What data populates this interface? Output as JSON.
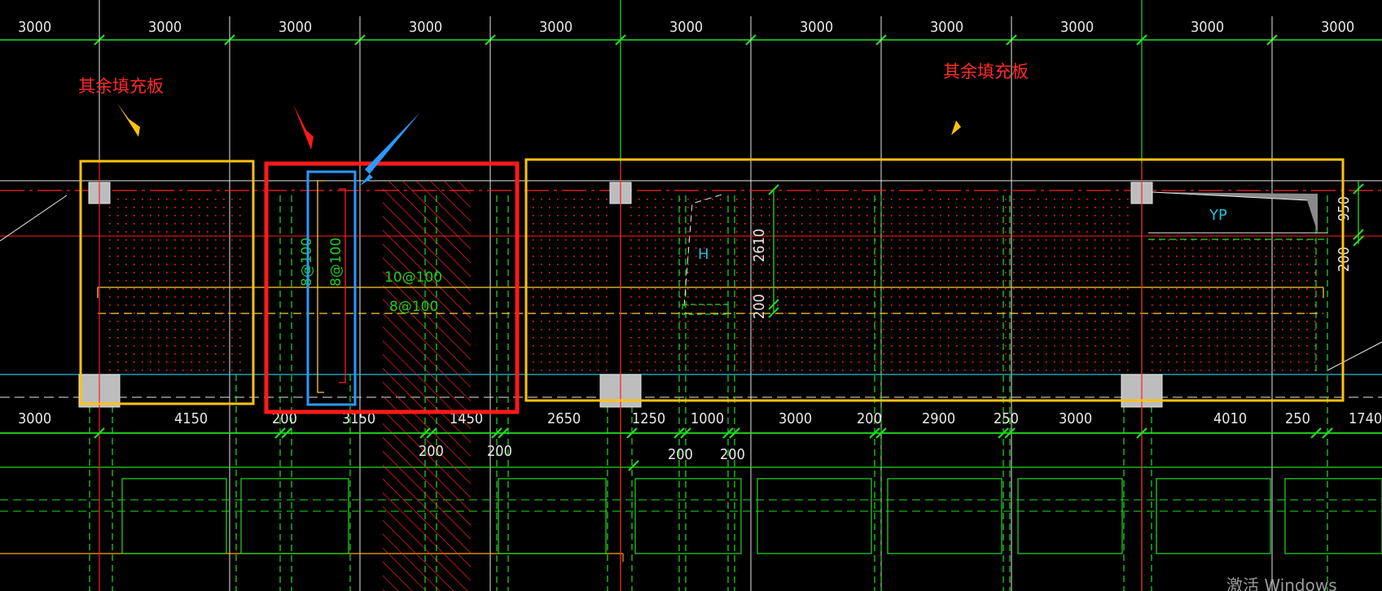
{
  "colors": {
    "background": "#000000",
    "grid_green": "#22dd22",
    "grid_white": "#e8e8e8",
    "axis_red": "#ff2020",
    "callout_yellow": "#ffc20e",
    "callout_red": "#ff1a1a",
    "callout_blue": "#2a9aff",
    "cyan": "#22c0d8",
    "dash_yellow": "#ffcc33",
    "column_gray": "#c8c8c8"
  },
  "top_dimensions": [
    "3000",
    "3000",
    "3000",
    "3000",
    "3000",
    "3000",
    "3000",
    "3000",
    "3000",
    "3000",
    "3000"
  ],
  "bottom_dimensions": {
    "row1": [
      "3000",
      "4150",
      "200",
      "3150",
      "1450",
      "2650",
      "1250",
      "1000",
      "3000",
      "200",
      "2900",
      "250",
      "3000",
      "4010",
      "250",
      "1740"
    ],
    "row2": [
      "200",
      "200",
      "200",
      "200"
    ]
  },
  "annotations": {
    "left_note": "其余填充板",
    "right_note": "其余填充板",
    "rebar_vertical_1": "8@100",
    "rebar_vertical_2": "8@100",
    "rebar_h_1": "10@100",
    "rebar_h_2": "8@100",
    "label_h": "H",
    "label_yp": "YP",
    "dim_2610": "2610",
    "dim_200_mid": "200",
    "dim_950": "950",
    "dim_200_right": "200"
  },
  "watermark": "激活 Windows",
  "icons": [
    "arrow-yellow-left-icon",
    "arrow-red-icon",
    "arrow-blue-icon",
    "arrow-yellow-right-icon"
  ]
}
